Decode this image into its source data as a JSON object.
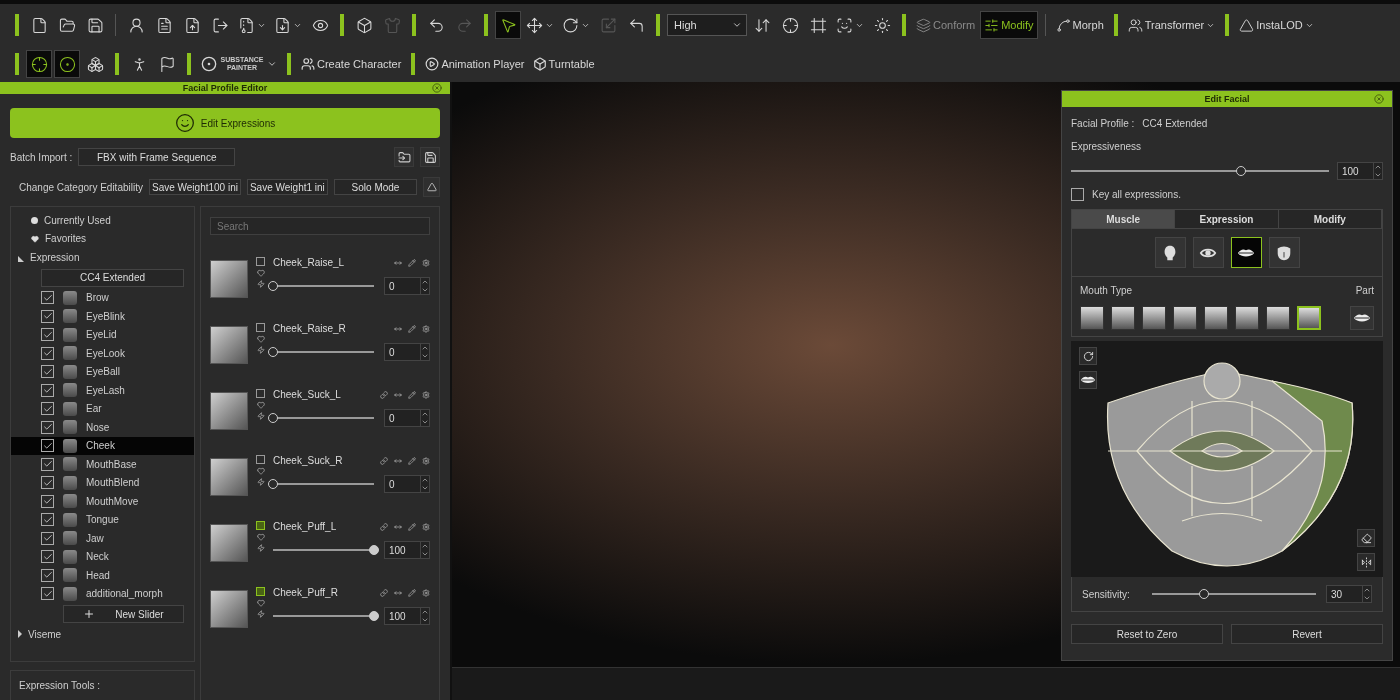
{
  "toolbar": {
    "tool_groups": [
      [
        {
          "selected": false,
          "disabled": false,
          "has_menu": false
        },
        {
          "selected": false,
          "disabled": false,
          "has_menu": false
        },
        {
          "selected": false,
          "disabled": false,
          "has_menu": false
        }
      ],
      [
        {
          "selected": false,
          "disabled": false,
          "has_menu": false
        },
        {
          "selected": false,
          "disabled": false,
          "has_menu": false
        },
        {
          "selected": false,
          "disabled": false,
          "has_menu": false
        },
        {
          "selected": false,
          "disabled": false,
          "has_menu": false
        },
        {
          "selected": false,
          "disabled": false,
          "has_menu": true
        },
        {
          "selected": false,
          "disabled": false,
          "has_menu": true
        },
        {
          "selected": false,
          "disabled": false,
          "has_menu": false
        }
      ],
      [
        {
          "selected": false,
          "disabled": false,
          "has_menu": false
        },
        {
          "selected": false,
          "disabled": true,
          "has_menu": false
        }
      ],
      [
        {
          "selected": false,
          "disabled": false,
          "has_menu": false
        },
        {
          "selected": false,
          "disabled": true,
          "has_menu": false
        }
      ],
      [
        {
          "selected": true,
          "disabled": false,
          "has_menu": false
        },
        {
          "selected": false,
          "disabled": false,
          "has_menu": true
        },
        {
          "selected": false,
          "disabled": false,
          "has_menu": true
        },
        {
          "selected": false,
          "disabled": true,
          "has_menu": false
        },
        {
          "selected": false,
          "disabled": false,
          "has_menu": false
        }
      ]
    ],
    "quality": "High",
    "view_tools": [
      {
        "selected": false,
        "disabled": false,
        "has_menu": false
      },
      {
        "selected": false,
        "disabled": false,
        "has_menu": false
      },
      {
        "selected": false,
        "disabled": false,
        "has_menu": false
      },
      {
        "selected": false,
        "disabled": false,
        "has_menu": true
      },
      {
        "selected": false,
        "disabled": false,
        "has_menu": false
      }
    ],
    "mode_groups": [
      [
        {
          "label": "Conform",
          "selected": false,
          "disabled": true,
          "has_menu": false
        },
        {
          "label": "Modify",
          "selected": true,
          "disabled": false,
          "has_menu": false
        }
      ],
      [
        {
          "label": "Morph",
          "selected": false,
          "disabled": false,
          "has_menu": false
        }
      ],
      [
        {
          "label": "Transformer",
          "selected": false,
          "disabled": false,
          "has_menu": true
        }
      ],
      [
        {
          "label": "InstaLOD",
          "selected": false,
          "disabled": false,
          "has_menu": true
        }
      ]
    ],
    "row_2_tools": [
      {
        "selected": true
      },
      {
        "selected": true
      },
      {
        "selected": false
      }
    ],
    "row_2_misc": [
      {
        "selected": false
      },
      {
        "selected": false
      }
    ],
    "substance_label": "SUBSTANCE PAINTER",
    "row_2_buttons": [
      [
        "Create Character"
      ],
      [
        "Animation Player",
        "Turntable"
      ]
    ]
  },
  "facial_profile_editor": {
    "title": "Facial Profile Editor",
    "edit_button": "Edit Expressions",
    "batch_import": {
      "label": "Batch Import :",
      "value": "FBX with Frame Sequence"
    },
    "category_row": {
      "label": "Change Category Editability",
      "buttons": [
        "Save Weight100 ini",
        "Save Weight1 ini",
        "Solo Mode"
      ]
    },
    "filters": [
      {
        "label": "Currently Used",
        "kind": "dot"
      },
      {
        "label": "Favorites",
        "kind": "heart"
      }
    ],
    "groups": [
      {
        "label": "Expression",
        "expanded": true,
        "profile_button": "CC4 Extended",
        "add_button": "New Slider",
        "categories": [
          {
            "label": "Brow",
            "checked": true,
            "selected": false
          },
          {
            "label": "EyeBlink",
            "checked": true,
            "selected": false
          },
          {
            "label": "EyeLid",
            "checked": true,
            "selected": false
          },
          {
            "label": "EyeLook",
            "checked": true,
            "selected": false
          },
          {
            "label": "EyeBall",
            "checked": true,
            "selected": false
          },
          {
            "label": "EyeLash",
            "checked": true,
            "selected": false
          },
          {
            "label": "Ear",
            "checked": true,
            "selected": false
          },
          {
            "label": "Nose",
            "checked": true,
            "selected": false
          },
          {
            "label": "Cheek",
            "checked": true,
            "selected": true
          },
          {
            "label": "MouthBase",
            "checked": true,
            "selected": false
          },
          {
            "label": "MouthBlend",
            "checked": true,
            "selected": false
          },
          {
            "label": "MouthMove",
            "checked": true,
            "selected": false
          },
          {
            "label": "Tongue",
            "checked": true,
            "selected": false
          },
          {
            "label": "Jaw",
            "checked": true,
            "selected": false
          },
          {
            "label": "Neck",
            "checked": true,
            "selected": false
          },
          {
            "label": "Head",
            "checked": true,
            "selected": false
          },
          {
            "label": "additional_morph",
            "checked": true,
            "selected": false
          }
        ]
      },
      {
        "label": "Viseme",
        "expanded": false
      }
    ],
    "search": {
      "placeholder": "Search"
    },
    "sliders": [
      {
        "name": "Cheek_Raise_L",
        "highlighted": false,
        "linked": false,
        "level": 0,
        "value": "0"
      },
      {
        "name": "Cheek_Raise_R",
        "highlighted": false,
        "linked": false,
        "level": 0,
        "value": "0"
      },
      {
        "name": "Cheek_Suck_L",
        "highlighted": false,
        "linked": true,
        "level": 0,
        "value": "0"
      },
      {
        "name": "Cheek_Suck_R",
        "highlighted": false,
        "linked": true,
        "level": 0,
        "value": "0"
      },
      {
        "name": "Cheek_Puff_L",
        "highlighted": true,
        "linked": true,
        "level": 1,
        "value": "100"
      },
      {
        "name": "Cheek_Puff_R",
        "highlighted": true,
        "linked": true,
        "level": 1,
        "value": "100"
      }
    ],
    "tools_label": "Expression Tools :"
  },
  "edit_facial": {
    "title": "Edit Facial",
    "profile_label": "Facial Profile :",
    "profile_value": "CC4 Extended",
    "expressiveness": {
      "label": "Expressiveness",
      "level": 0.66,
      "value": "100"
    },
    "key_all": {
      "label": "Key all expressions.",
      "checked": false
    },
    "tabs": [
      {
        "label": "Muscle",
        "selected": true
      },
      {
        "label": "Expression",
        "selected": false
      },
      {
        "label": "Modify",
        "selected": false
      }
    ],
    "regions": [
      {
        "selected": false
      },
      {
        "selected": false
      },
      {
        "selected": true
      },
      {
        "selected": false
      }
    ],
    "mouth_type": {
      "label": "Mouth Type",
      "part_label": "Part",
      "options": [
        {
          "selected": false
        },
        {
          "selected": false
        },
        {
          "selected": false
        },
        {
          "selected": false
        },
        {
          "selected": false
        },
        {
          "selected": false
        },
        {
          "selected": false
        },
        {
          "selected": true
        }
      ]
    },
    "sensitivity": {
      "label": "Sensitivity:",
      "level": 0.32,
      "value": "30"
    },
    "buttons": [
      "Reset to Zero",
      "Revert"
    ]
  }
}
